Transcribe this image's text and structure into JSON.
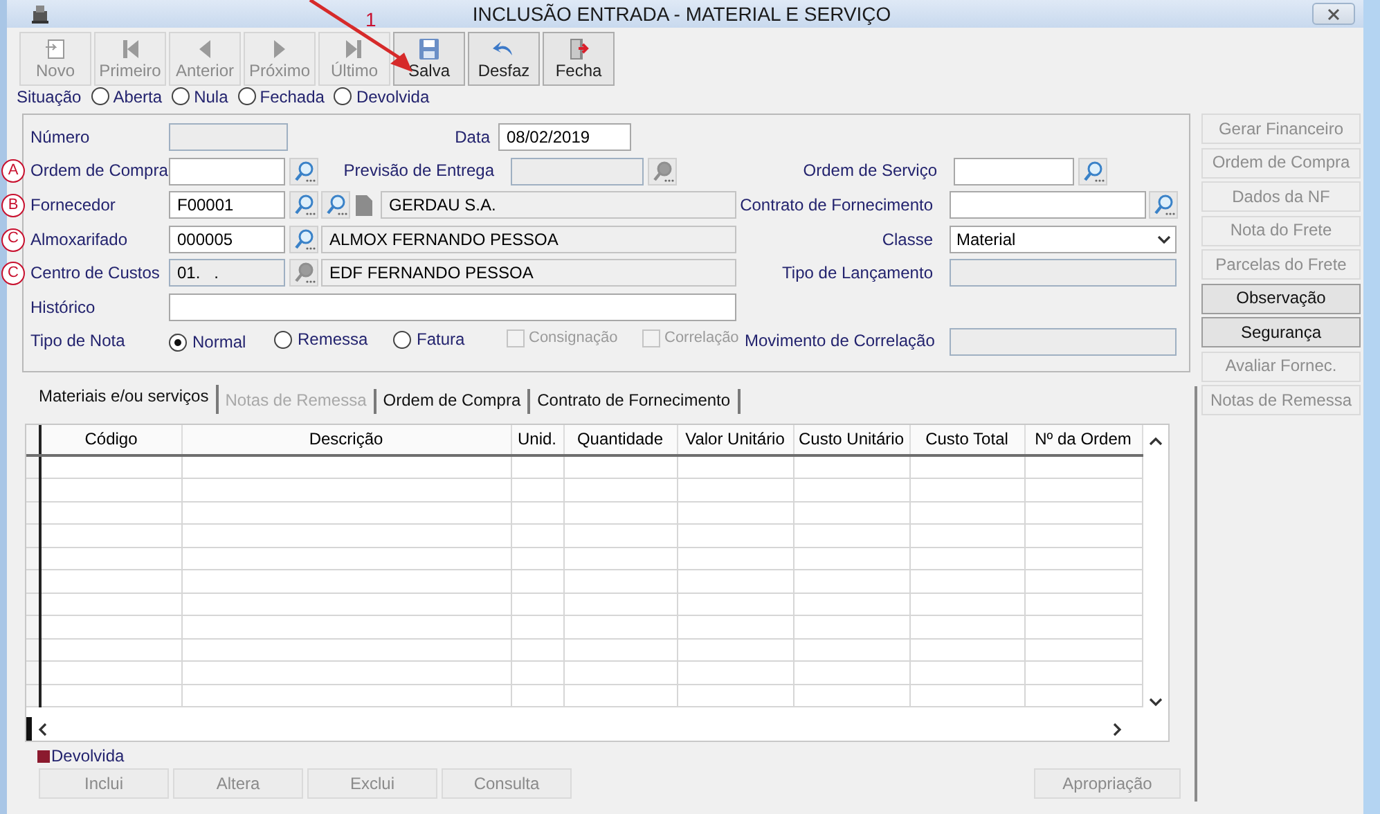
{
  "window": {
    "title": "INCLUSÃO ENTRADA - MATERIAL E SERVIÇO"
  },
  "annotation": {
    "label": "1"
  },
  "toolbar": [
    {
      "label": "Novo",
      "kind": "new",
      "disabled": true
    },
    {
      "label": "Primeiro",
      "kind": "first",
      "disabled": true
    },
    {
      "label": "Anterior",
      "kind": "prev",
      "disabled": true
    },
    {
      "label": "Próximo",
      "kind": "next",
      "disabled": true
    },
    {
      "label": "Último",
      "kind": "last",
      "disabled": true
    },
    {
      "label": "Salva",
      "kind": "save",
      "disabled": false
    },
    {
      "label": "Desfaz",
      "kind": "undo",
      "disabled": false
    },
    {
      "label": "Fecha",
      "kind": "exit",
      "disabled": false
    }
  ],
  "situacao": {
    "label": "Situação",
    "options": [
      {
        "label": "Aberta",
        "selected": false
      },
      {
        "label": "Nula",
        "selected": false
      },
      {
        "label": "Fechada",
        "selected": false
      },
      {
        "label": "Devolvida",
        "selected": false
      }
    ]
  },
  "form": {
    "numero": {
      "label": "Número",
      "disabled": true
    },
    "data": {
      "label": "Data",
      "value": "08/02/2019",
      "disabled": false
    },
    "ordem_compra": {
      "label": "Ordem de Compra",
      "marker": "A",
      "disabled": false
    },
    "previsao_entrega": {
      "label": "Previsão de Entrega",
      "disabled": true
    },
    "ordem_servico": {
      "label": "Ordem de Serviço",
      "disabled": false
    },
    "fornecedor": {
      "label": "Fornecedor",
      "marker": "B",
      "value": "F00001",
      "name": "GERDAU S.A.",
      "disabled": false
    },
    "contrato_fornecimento": {
      "label": "Contrato de Fornecimento",
      "disabled": false
    },
    "almoxarifado": {
      "label": "Almoxarifado",
      "marker": "C",
      "value": "000005",
      "name": "ALMOX FERNANDO PESSOA",
      "disabled": false
    },
    "classe": {
      "label": "Classe",
      "value": "Material"
    },
    "centro_custos": {
      "label": "Centro de Custos",
      "marker": "C",
      "value": "01.   .",
      "name": "EDF FERNANDO PESSOA",
      "disabled": true
    },
    "tipo_lancamento": {
      "label": "Tipo de Lançamento",
      "disabled": true
    },
    "historico": {
      "label": "Histórico",
      "disabled": false
    },
    "tipo_nota": {
      "label": "Tipo de Nota",
      "options": [
        {
          "label": "Normal",
          "selected": true
        },
        {
          "label": "Remessa",
          "selected": false
        },
        {
          "label": "Fatura",
          "selected": false
        }
      ]
    },
    "flags": [
      {
        "label": "Consignação",
        "checked": false,
        "disabled": true
      },
      {
        "label": "Correlação",
        "checked": false,
        "disabled": true
      }
    ],
    "movimento_correlacao": {
      "label": "Movimento de Correlação",
      "disabled": true
    }
  },
  "side_buttons": [
    {
      "label": "Gerar Financeiro",
      "disabled": true
    },
    {
      "label": "Ordem de Compra",
      "disabled": true
    },
    {
      "label": "Dados da NF",
      "disabled": true
    },
    {
      "label": "Nota do Frete",
      "disabled": true
    },
    {
      "label": "Parcelas do Frete",
      "disabled": true
    },
    {
      "label": "Observação",
      "disabled": false
    },
    {
      "label": "Segurança",
      "disabled": false
    },
    {
      "label": "Avaliar Fornec.",
      "disabled": true
    },
    {
      "label": "Notas de Remessa",
      "disabled": true
    }
  ],
  "tabs": [
    {
      "label": "Materiais e/ou serviços",
      "selected": true,
      "disabled": false
    },
    {
      "label": "Notas de Remessa",
      "selected": false,
      "disabled": true
    },
    {
      "label": "Ordem de Compra",
      "selected": false,
      "disabled": false
    },
    {
      "label": "Contrato de Fornecimento",
      "selected": false,
      "disabled": false
    }
  ],
  "table": {
    "columns": [
      "Código",
      "Descrição",
      "Unid.",
      "Quantidade",
      "Valor Unitário",
      "Custo Unitário",
      "Custo Total",
      "Nº da Ordem"
    ]
  },
  "legend": {
    "label": "Devolvida",
    "color": "#8b1a2e"
  },
  "bottom_buttons": [
    {
      "label": "Inclui",
      "disabled": true
    },
    {
      "label": "Altera",
      "disabled": true
    },
    {
      "label": "Exclui",
      "disabled": true
    },
    {
      "label": "Consulta",
      "disabled": true
    }
  ],
  "apropriacao": {
    "label": "Apropriação",
    "disabled": true
  }
}
